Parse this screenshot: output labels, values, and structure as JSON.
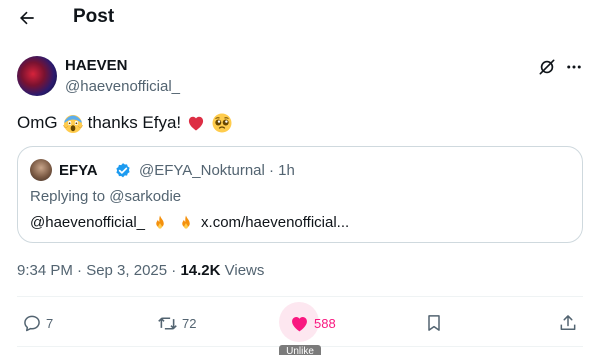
{
  "header": {
    "title": "Post"
  },
  "post": {
    "author": {
      "display_name": "HAEVEN",
      "handle": "@haevenofficial_"
    },
    "text_before": "OmG",
    "text_middle": "thanks Efya!",
    "emojis": [
      "scream-emoji",
      "red-heart-emoji",
      "pleading-face-emoji"
    ],
    "timestamp": "9:34 PM · Sep 3, 2025 · ",
    "views_count": "14.2K",
    "views_label": " Views"
  },
  "quote": {
    "display_name": "EFYA",
    "handle_time": "@EFYA_Nokturnal · 1h",
    "replying_to": "Replying to @sarkodie",
    "mention": "@haevenofficial_",
    "link": "x.com/haevenofficial...",
    "emojis": [
      "fire-emoji",
      "fire-emoji"
    ]
  },
  "actions": {
    "replies": "7",
    "reposts": "72",
    "likes": "588",
    "like_tooltip": "Unlike"
  },
  "colors": {
    "like_accent": "#f91880",
    "verified_blue": "#1d9bf0",
    "muted_text": "#536471",
    "border": "#cfd9de"
  }
}
